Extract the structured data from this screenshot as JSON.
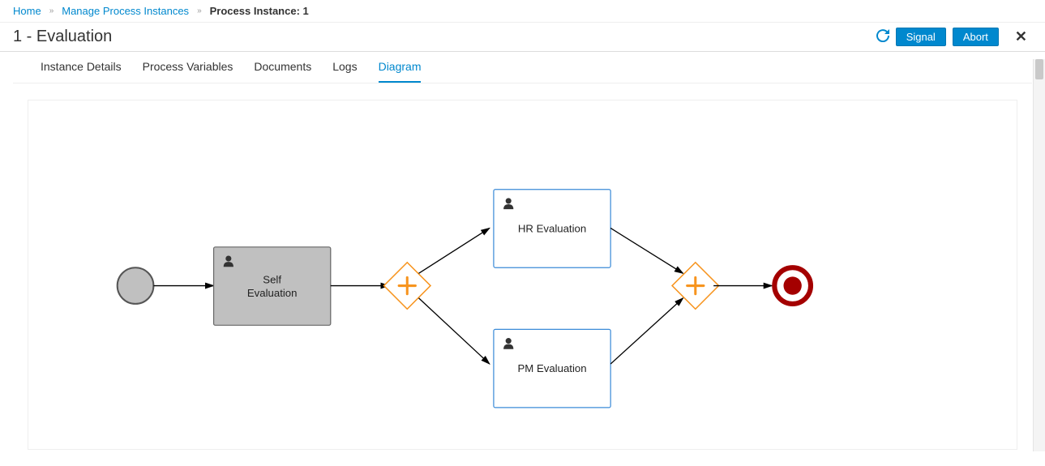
{
  "breadcrumbs": {
    "home": "Home",
    "manage": "Manage Process Instances",
    "current": "Process Instance: 1"
  },
  "header": {
    "title": "1 - Evaluation",
    "signal": "Signal",
    "abort": "Abort"
  },
  "tabs": {
    "details": "Instance Details",
    "vars": "Process Variables",
    "docs": "Documents",
    "logs": "Logs",
    "diagram": "Diagram"
  },
  "diagram": {
    "self_l1": "Self",
    "self_l2": "Evaluation",
    "hr": "HR Evaluation",
    "pm": "PM Evaluation"
  }
}
